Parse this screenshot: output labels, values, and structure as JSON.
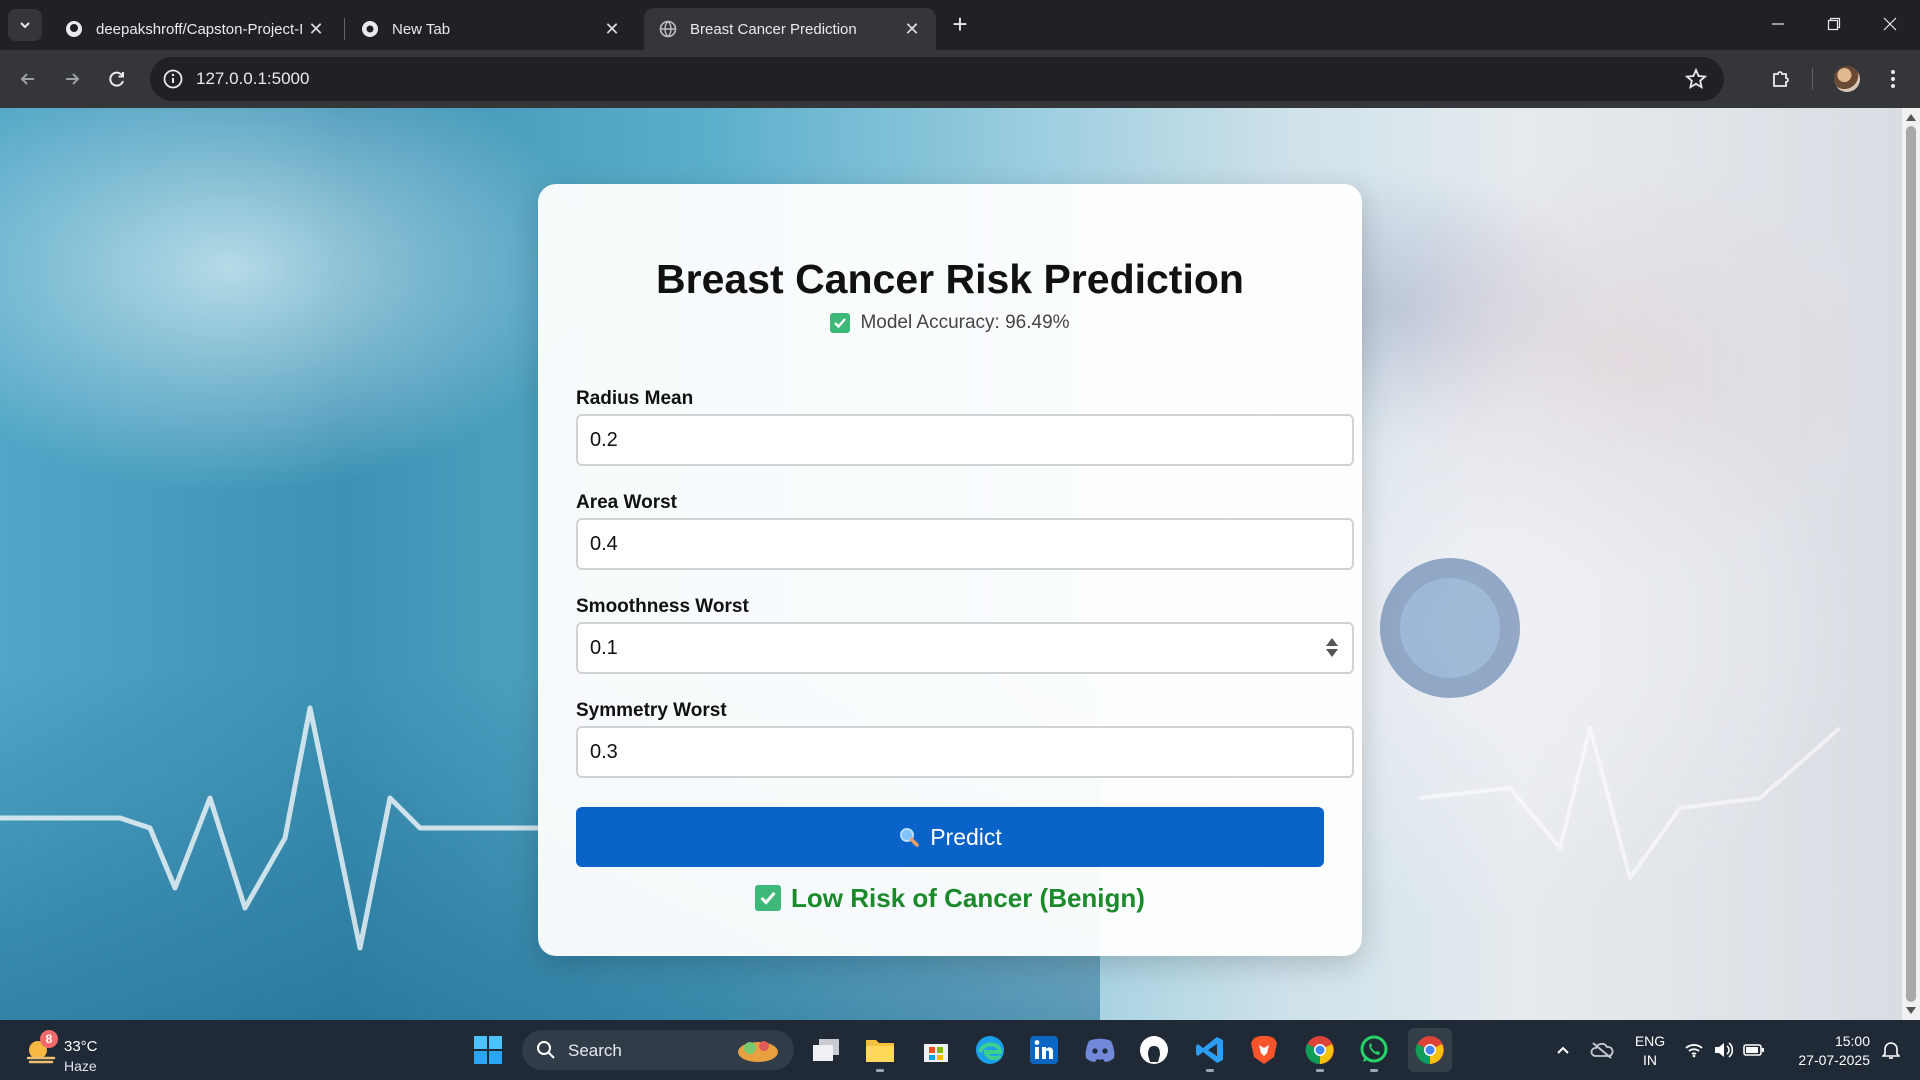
{
  "browser": {
    "tabs": [
      {
        "title": "deepakshroff/Capston-Project-I",
        "favicon": "github-icon"
      },
      {
        "title": "New Tab",
        "favicon": "chrome-icon"
      },
      {
        "title": "Breast Cancer Prediction",
        "favicon": "globe-icon"
      }
    ],
    "url": "127.0.0.1:5000"
  },
  "page": {
    "title": "Breast Cancer Risk Prediction",
    "accuracy": "Model Accuracy: 96.49%",
    "fields": [
      {
        "label": "Radius Mean",
        "value": "0.2"
      },
      {
        "label": "Area Worst",
        "value": "0.4"
      },
      {
        "label": "Smoothness Worst",
        "value": "0.1"
      },
      {
        "label": "Symmetry Worst",
        "value": "0.3"
      }
    ],
    "predict_button": "Predict",
    "result": "Low Risk of Cancer (Benign)",
    "colors": {
      "primary": "#0a63c9",
      "success": "#1a8a2a",
      "check": "#3cb878"
    }
  },
  "taskbar": {
    "weather": {
      "badge": "8",
      "temp": "33°C",
      "condition": "Haze"
    },
    "search_label": "Search",
    "lang_top": "ENG",
    "lang_bottom": "IN",
    "time": "15:00",
    "date": "27-07-2025"
  }
}
